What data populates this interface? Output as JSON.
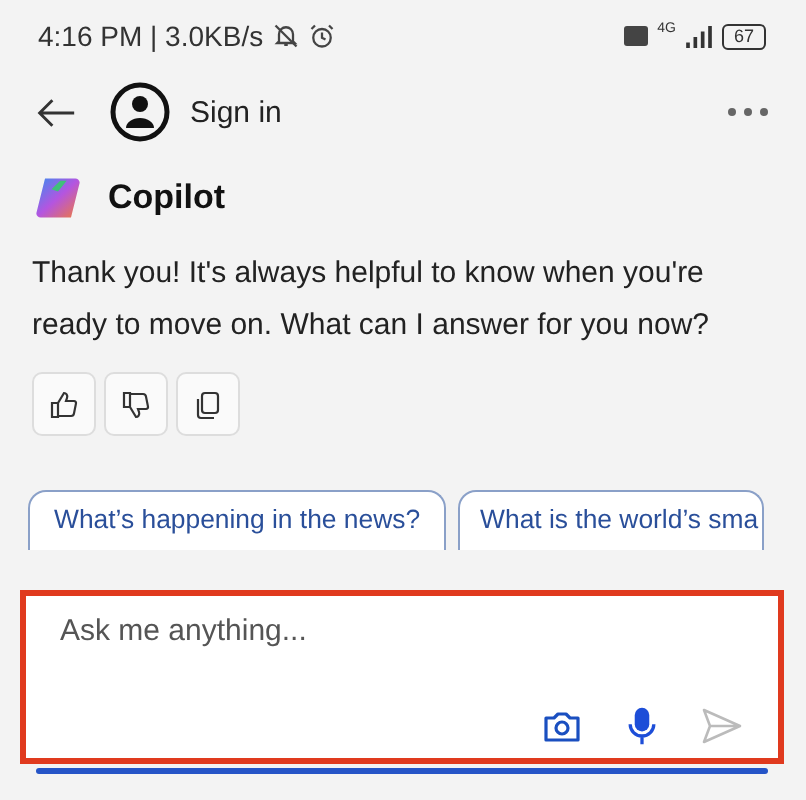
{
  "status_bar": {
    "time": "4:16 PM | 3.0KB/s",
    "network": "4G",
    "battery": "67"
  },
  "header": {
    "sign_in": "Sign in"
  },
  "assistant": {
    "name": "Copilot"
  },
  "message": {
    "text": "Thank you! It's always helpful to know when you're ready to move on. What can I answer for you now?"
  },
  "feedback_buttons": [
    {
      "kind": "like"
    },
    {
      "kind": "dislike"
    },
    {
      "kind": "copy"
    }
  ],
  "suggestions": [
    "What’s happening in the news?",
    "What is the world’s sma"
  ],
  "composer": {
    "placeholder": "Ask me anything...",
    "highlighted": true
  }
}
